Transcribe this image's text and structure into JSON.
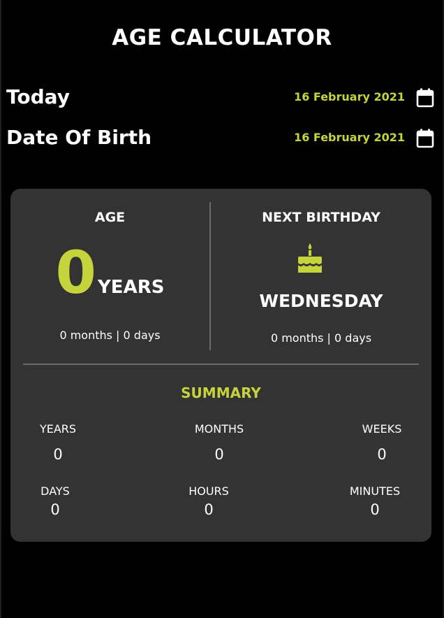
{
  "app": {
    "title": "AGE CALCULATOR"
  },
  "today": {
    "label": "Today",
    "value": "16 February 2021",
    "icon": "calendar-icon"
  },
  "dob": {
    "label": "Date Of Birth",
    "value": "16 February 2021",
    "icon": "calendar-icon"
  },
  "age": {
    "heading": "AGE",
    "years": "0",
    "unit": "YEARS",
    "detail": "0 months | 0 days"
  },
  "next_birthday": {
    "heading": "NEXT BIRTHDAY",
    "icon": "birthday-cake-icon",
    "weekday": "WEDNESDAY",
    "detail": "0 months | 0 days"
  },
  "summary": {
    "title": "SUMMARY",
    "items": [
      {
        "label": "YEARS",
        "value": "0"
      },
      {
        "label": "MONTHS",
        "value": "0"
      },
      {
        "label": "WEEKS",
        "value": "0"
      },
      {
        "label": "DAYS",
        "value": "0"
      },
      {
        "label": "HOURS",
        "value": "0"
      },
      {
        "label": "MINUTES",
        "value": "0"
      }
    ]
  },
  "colors": {
    "background": "#000000",
    "card": "#333333",
    "accent": "#c6d43b",
    "text": "#ffffff"
  }
}
